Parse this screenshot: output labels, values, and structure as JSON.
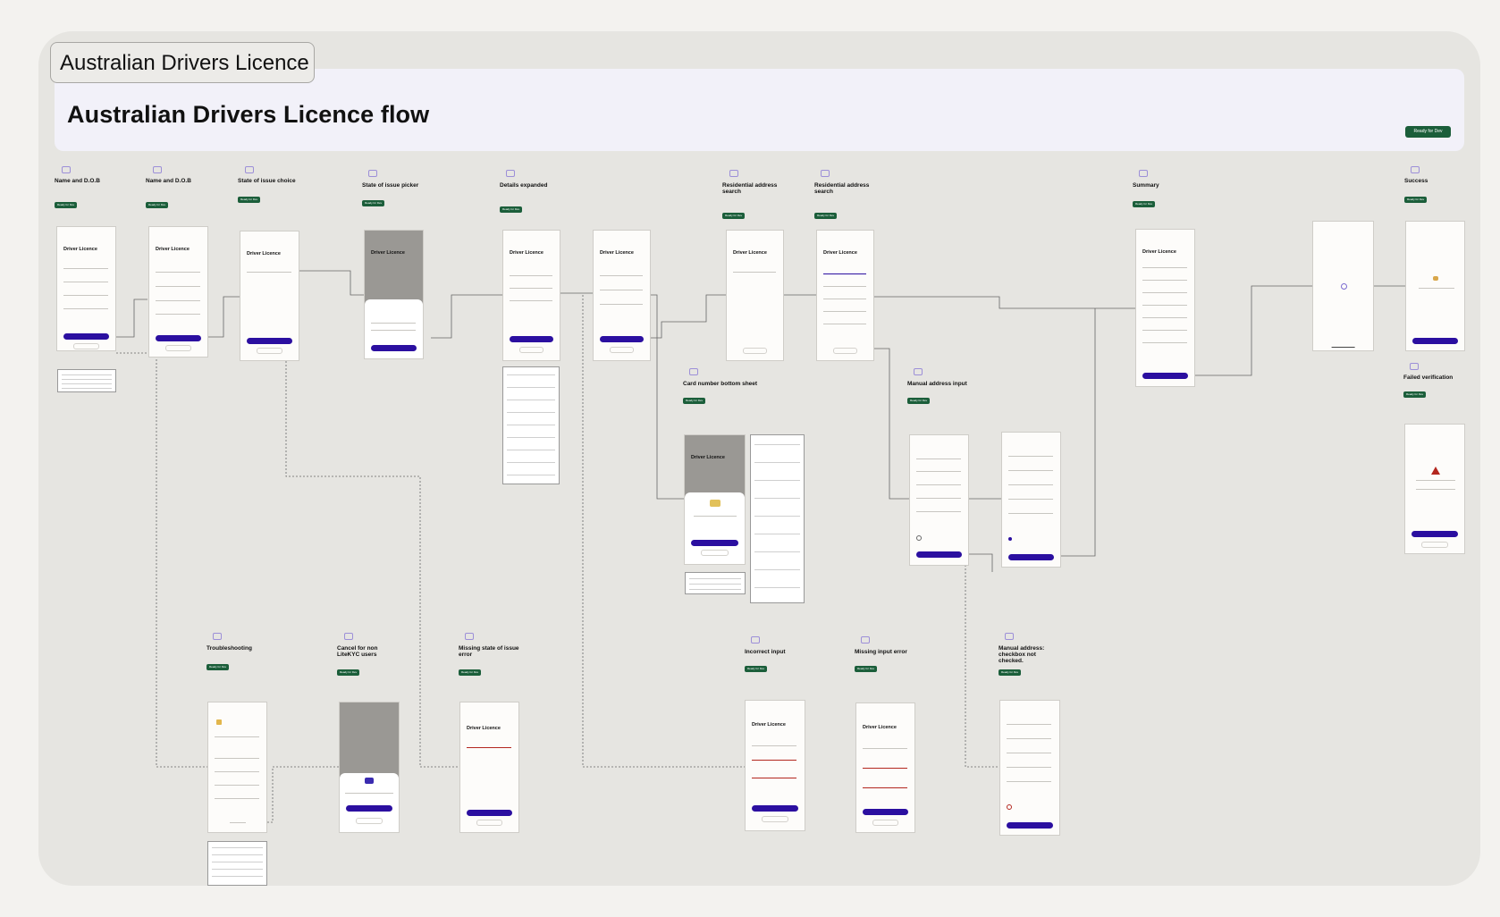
{
  "section": {
    "tag": "Australian Drivers Licence"
  },
  "header": {
    "title": "Australian Drivers Licence flow",
    "status": "Ready for Dev"
  },
  "screen_title": "Driver Licence",
  "screens_top": [
    {
      "label": "Name and D.O.B"
    },
    {
      "label": "Name and D.O.B"
    },
    {
      "label": "State of issue choice"
    },
    {
      "label": "State of issue picker"
    },
    {
      "label": "Details expanded"
    },
    {
      "label": "Residential address search"
    },
    {
      "label": "Residential address search"
    },
    {
      "label": "Summary"
    },
    {
      "label": "Success"
    }
  ],
  "screens_mid": [
    {
      "label": "Card number bottom sheet"
    },
    {
      "label": "Manual address input"
    },
    {
      "label": "Failed verification"
    }
  ],
  "screens_bottom": [
    {
      "label": "Troubleshooting"
    },
    {
      "label": "Cancel for non LiteKYC users"
    },
    {
      "label": "Missing state of issue error"
    },
    {
      "label": "Incorrect input"
    },
    {
      "label": "Missing input error"
    },
    {
      "label": "Manual address: checkbox not checked."
    }
  ],
  "tag_label": "Ready for Dev",
  "colors": {
    "primary": "#2b0fa0",
    "status": "#1b5e3a",
    "canvas": "#e6e5e1"
  }
}
